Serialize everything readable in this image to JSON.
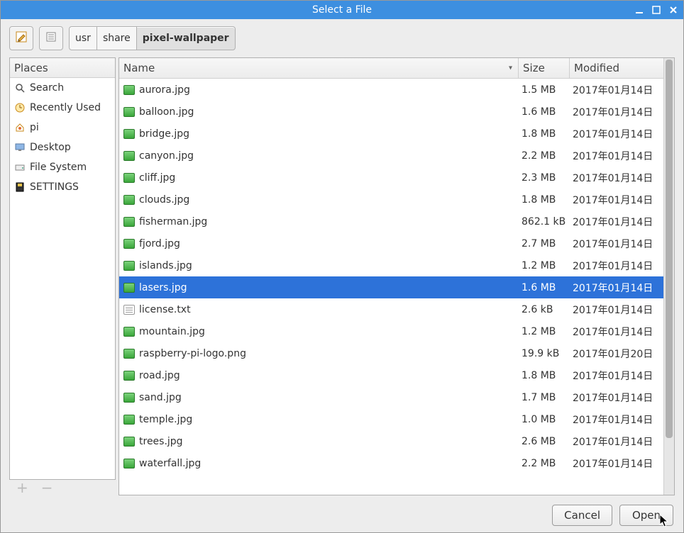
{
  "window": {
    "title": "Select a File"
  },
  "toolbar": {
    "path": [
      "usr",
      "share",
      "pixel-wallpaper"
    ],
    "active_index": 2
  },
  "places": {
    "header": "Places",
    "items": [
      {
        "label": "Search",
        "icon": "search-icon"
      },
      {
        "label": "Recently Used",
        "icon": "recent-icon"
      },
      {
        "label": "pi",
        "icon": "home-icon"
      },
      {
        "label": "Desktop",
        "icon": "desktop-icon"
      },
      {
        "label": "File System",
        "icon": "drive-icon"
      },
      {
        "label": "SETTINGS",
        "icon": "disk-icon"
      }
    ]
  },
  "columns": {
    "name": "Name",
    "size": "Size",
    "modified": "Modified"
  },
  "files": [
    {
      "name": "aurora.jpg",
      "size": "1.5 MB",
      "modified": "2017年01月14日",
      "type": "image"
    },
    {
      "name": "balloon.jpg",
      "size": "1.6 MB",
      "modified": "2017年01月14日",
      "type": "image"
    },
    {
      "name": "bridge.jpg",
      "size": "1.8 MB",
      "modified": "2017年01月14日",
      "type": "image"
    },
    {
      "name": "canyon.jpg",
      "size": "2.2 MB",
      "modified": "2017年01月14日",
      "type": "image"
    },
    {
      "name": "cliff.jpg",
      "size": "2.3 MB",
      "modified": "2017年01月14日",
      "type": "image"
    },
    {
      "name": "clouds.jpg",
      "size": "1.8 MB",
      "modified": "2017年01月14日",
      "type": "image"
    },
    {
      "name": "fisherman.jpg",
      "size": "862.1 kB",
      "modified": "2017年01月14日",
      "type": "image"
    },
    {
      "name": "fjord.jpg",
      "size": "2.7 MB",
      "modified": "2017年01月14日",
      "type": "image"
    },
    {
      "name": "islands.jpg",
      "size": "1.2 MB",
      "modified": "2017年01月14日",
      "type": "image"
    },
    {
      "name": "lasers.jpg",
      "size": "1.6 MB",
      "modified": "2017年01月14日",
      "type": "image",
      "selected": true
    },
    {
      "name": "license.txt",
      "size": "2.6 kB",
      "modified": "2017年01月14日",
      "type": "text"
    },
    {
      "name": "mountain.jpg",
      "size": "1.2 MB",
      "modified": "2017年01月14日",
      "type": "image"
    },
    {
      "name": "raspberry-pi-logo.png",
      "size": "19.9 kB",
      "modified": "2017年01月20日",
      "type": "image"
    },
    {
      "name": "road.jpg",
      "size": "1.8 MB",
      "modified": "2017年01月14日",
      "type": "image"
    },
    {
      "name": "sand.jpg",
      "size": "1.7 MB",
      "modified": "2017年01月14日",
      "type": "image"
    },
    {
      "name": "temple.jpg",
      "size": "1.0 MB",
      "modified": "2017年01月14日",
      "type": "image"
    },
    {
      "name": "trees.jpg",
      "size": "2.6 MB",
      "modified": "2017年01月14日",
      "type": "image"
    },
    {
      "name": "waterfall.jpg",
      "size": "2.2 MB",
      "modified": "2017年01月14日",
      "type": "image"
    }
  ],
  "footer": {
    "cancel": "Cancel",
    "open": "Open"
  }
}
